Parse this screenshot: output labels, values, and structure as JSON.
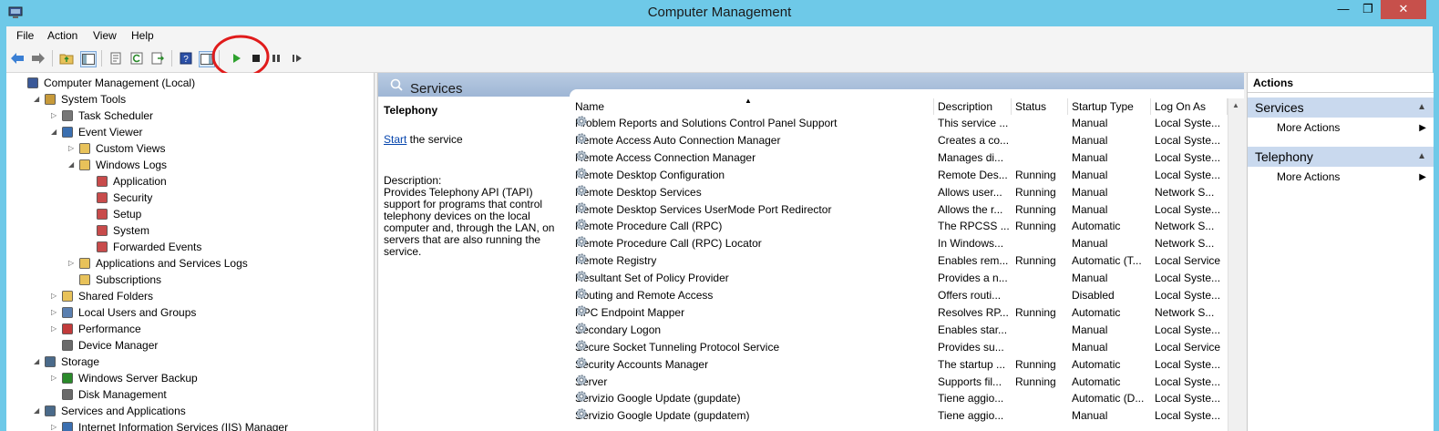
{
  "window": {
    "title": "Computer Management",
    "minimize_glyph": "—",
    "restore_glyph": "❐",
    "close_glyph": "✕"
  },
  "menu": [
    "File",
    "Action",
    "View",
    "Help"
  ],
  "colors": {
    "title_bar": "#6ec9e8",
    "header_gradient": "#9fb6d5",
    "action_group": "#c9d9ee",
    "highlight_circle": "#e01b1b",
    "play_green": "#2ea12e",
    "link": "#0645ad"
  },
  "toolbar_icons": [
    "back-arrow-icon",
    "forward-arrow-icon",
    "up-folder-icon",
    "show-hide-console-tree-icon",
    "properties-icon",
    "refresh-icon",
    "export-list-icon",
    "help-icon",
    "show-hide-action-pane-icon",
    "start-service-icon",
    "stop-service-icon",
    "pause-service-icon",
    "restart-service-icon"
  ],
  "tree": {
    "items": [
      {
        "label": "Computer Management (Local)",
        "icon": "computer-icon",
        "expander": ""
      },
      {
        "label": "System Tools",
        "icon": "tools-icon",
        "expander": "◢"
      },
      {
        "label": "Task Scheduler",
        "icon": "clock-icon",
        "expander": "▷"
      },
      {
        "label": "Event Viewer",
        "icon": "event-viewer-icon",
        "expander": "◢"
      },
      {
        "label": "Custom Views",
        "icon": "folder-icon",
        "expander": "▷"
      },
      {
        "label": "Windows Logs",
        "icon": "folder-icon",
        "expander": "◢"
      },
      {
        "label": "Application",
        "icon": "log-icon",
        "expander": ""
      },
      {
        "label": "Security",
        "icon": "log-icon",
        "expander": ""
      },
      {
        "label": "Setup",
        "icon": "log-icon",
        "expander": ""
      },
      {
        "label": "System",
        "icon": "log-icon",
        "expander": ""
      },
      {
        "label": "Forwarded Events",
        "icon": "log-icon",
        "expander": ""
      },
      {
        "label": "Applications and Services Logs",
        "icon": "folder-icon",
        "expander": "▷"
      },
      {
        "label": "Subscriptions",
        "icon": "subscriptions-icon",
        "expander": ""
      },
      {
        "label": "Shared Folders",
        "icon": "shared-folder-icon",
        "expander": "▷"
      },
      {
        "label": "Local Users and Groups",
        "icon": "users-icon",
        "expander": "▷"
      },
      {
        "label": "Performance",
        "icon": "performance-icon",
        "expander": "▷"
      },
      {
        "label": "Device Manager",
        "icon": "device-manager-icon",
        "expander": ""
      },
      {
        "label": "Storage",
        "icon": "storage-icon",
        "expander": "◢"
      },
      {
        "label": "Windows Server Backup",
        "icon": "backup-icon",
        "expander": "▷"
      },
      {
        "label": "Disk Management",
        "icon": "disk-icon",
        "expander": ""
      },
      {
        "label": "Services and Applications",
        "icon": "services-apps-icon",
        "expander": "◢"
      },
      {
        "label": "Internet Information Services (IIS) Manager",
        "icon": "iis-icon",
        "expander": "▷"
      }
    ]
  },
  "services_panel": {
    "header": "Services",
    "selected_name": "Telephony",
    "start_link": "Start",
    "start_suffix": " the service",
    "description_label": "Description:",
    "description_text": "Provides Telephony API (TAPI) support for programs that control telephony devices on the local computer and, through the LAN, on servers that are also running the service.",
    "columns": [
      "Name",
      "Description",
      "Status",
      "Startup Type",
      "Log On As"
    ],
    "sort_glyph": "▲",
    "rows": [
      {
        "name": "Problem Reports and Solutions Control Panel Support",
        "description": "This service ...",
        "status": "",
        "startup": "Manual",
        "logon": "Local Syste..."
      },
      {
        "name": "Remote Access Auto Connection Manager",
        "description": "Creates a co...",
        "status": "",
        "startup": "Manual",
        "logon": "Local Syste..."
      },
      {
        "name": "Remote Access Connection Manager",
        "description": "Manages di...",
        "status": "",
        "startup": "Manual",
        "logon": "Local Syste..."
      },
      {
        "name": "Remote Desktop Configuration",
        "description": "Remote Des...",
        "status": "Running",
        "startup": "Manual",
        "logon": "Local Syste..."
      },
      {
        "name": "Remote Desktop Services",
        "description": "Allows user...",
        "status": "Running",
        "startup": "Manual",
        "logon": "Network S..."
      },
      {
        "name": "Remote Desktop Services UserMode Port Redirector",
        "description": "Allows the r...",
        "status": "Running",
        "startup": "Manual",
        "logon": "Local Syste..."
      },
      {
        "name": "Remote Procedure Call (RPC)",
        "description": "The RPCSS ...",
        "status": "Running",
        "startup": "Automatic",
        "logon": "Network S..."
      },
      {
        "name": "Remote Procedure Call (RPC) Locator",
        "description": "In Windows...",
        "status": "",
        "startup": "Manual",
        "logon": "Network S..."
      },
      {
        "name": "Remote Registry",
        "description": "Enables rem...",
        "status": "Running",
        "startup": "Automatic (T...",
        "logon": "Local Service"
      },
      {
        "name": "Resultant Set of Policy Provider",
        "description": "Provides a n...",
        "status": "",
        "startup": "Manual",
        "logon": "Local Syste..."
      },
      {
        "name": "Routing and Remote Access",
        "description": "Offers routi...",
        "status": "",
        "startup": "Disabled",
        "logon": "Local Syste..."
      },
      {
        "name": "RPC Endpoint Mapper",
        "description": "Resolves RP...",
        "status": "Running",
        "startup": "Automatic",
        "logon": "Network S..."
      },
      {
        "name": "Secondary Logon",
        "description": "Enables star...",
        "status": "",
        "startup": "Manual",
        "logon": "Local Syste..."
      },
      {
        "name": "Secure Socket Tunneling Protocol Service",
        "description": "Provides su...",
        "status": "",
        "startup": "Manual",
        "logon": "Local Service"
      },
      {
        "name": "Security Accounts Manager",
        "description": "The startup ...",
        "status": "Running",
        "startup": "Automatic",
        "logon": "Local Syste..."
      },
      {
        "name": "Server",
        "description": "Supports fil...",
        "status": "Running",
        "startup": "Automatic",
        "logon": "Local Syste..."
      },
      {
        "name": "Servizio Google Update (gupdate)",
        "description": "Tiene aggio...",
        "status": "",
        "startup": "Automatic (D...",
        "logon": "Local Syste..."
      },
      {
        "name": "Servizio Google Update (gupdatem)",
        "description": "Tiene aggio...",
        "status": "",
        "startup": "Manual",
        "logon": "Local Syste..."
      }
    ]
  },
  "actions_pane": {
    "title": "Actions",
    "groups": [
      {
        "label": "Services",
        "item": "More Actions"
      },
      {
        "label": "Telephony",
        "item": "More Actions"
      }
    ],
    "collapse_glyph": "▲",
    "submenu_glyph": "▶"
  }
}
